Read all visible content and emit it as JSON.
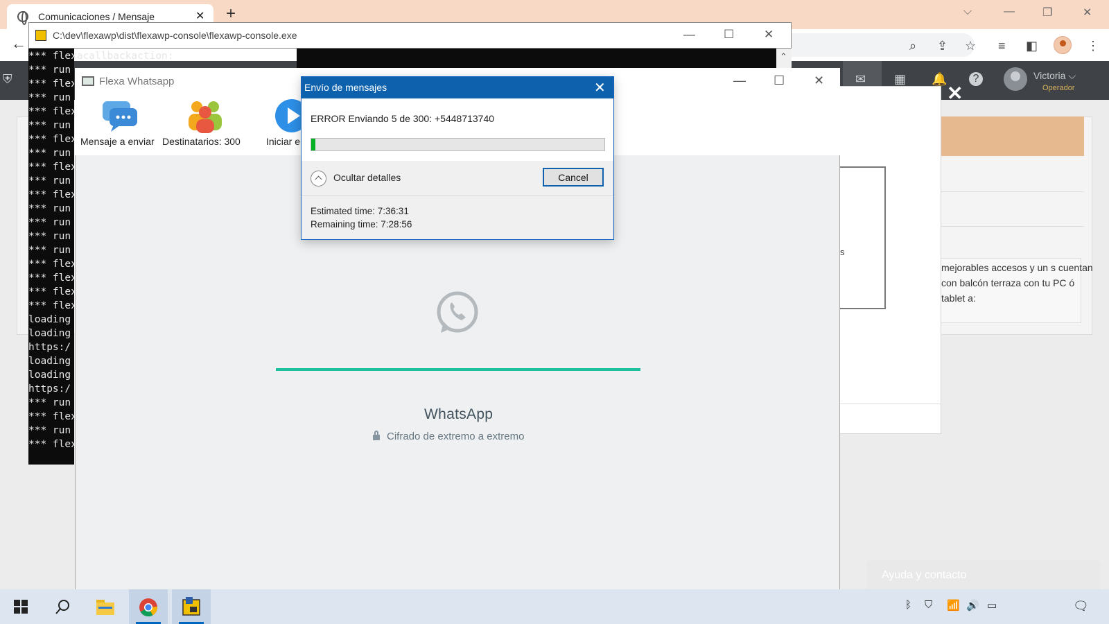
{
  "browser": {
    "tab_title": "Comunicaciones / Mensaje",
    "tab_close": "✕",
    "new_tab": "+",
    "win_controls": {
      "dropdown": "⌵",
      "minimize": "—",
      "restore": "❐",
      "close": "✕"
    }
  },
  "webapp": {
    "user_name": "Victoria ⌵",
    "user_role": "Operador",
    "modal_snippet": "s",
    "description_text": "mejorables accesos y un s cuentan con balcón terraza con tu PC ó tablet a:",
    "help_label": "Ayuda y contacto"
  },
  "console": {
    "title": "C:\\dev\\flexawp\\dist\\flexawp-console\\flexawp-console.exe",
    "lines": [
      "*** flexacallbackaction:",
      "*** run 76",
      "*** flex",
      "*** run",
      "*** flex",
      "*** run",
      "*** flex",
      "*** run",
      "*** flex",
      "*** run",
      "*** flex",
      "*** run",
      "*** run",
      "*** run",
      "*** run",
      "*** flex",
      "*** flex",
      "*** flex",
      "*** flex",
      "loading",
      "loading",
      "https:/",
      "loading",
      "loading",
      "https:/",
      "*** run",
      "*** flex",
      "*** run",
      "*** flex"
    ]
  },
  "flexa": {
    "title": "Flexa Whatsapp",
    "toolbar": {
      "message_label": "Mensaje a enviar",
      "recipients_label": "Destinatarios: 300",
      "start_label": "Iniciar en"
    },
    "whatsapp_title": "WhatsApp",
    "whatsapp_subtitle": "Cifrado de extremo a extremo"
  },
  "dialog": {
    "title": "Envío de mensajes",
    "message": "ERROR Enviando 5 de 300: +5448713740",
    "progress_fraction": 0.007,
    "toggle_label": "Ocultar detalles",
    "cancel_label": "Cancel",
    "estimated_time": "Estimated time: 7:36:31",
    "remaining_time": "Remaining time: 7:28:56"
  },
  "colors": {
    "tabstrip": "#f8d9c5",
    "dialog_title": "#0e62ad",
    "progress_fill": "#06b025",
    "whatsapp_line": "#1ebe9f"
  },
  "taskbar": {
    "icons": [
      "windows-start-icon",
      "search-icon",
      "file-explorer-icon",
      "chrome-icon",
      "flexa-app-icon"
    ]
  }
}
